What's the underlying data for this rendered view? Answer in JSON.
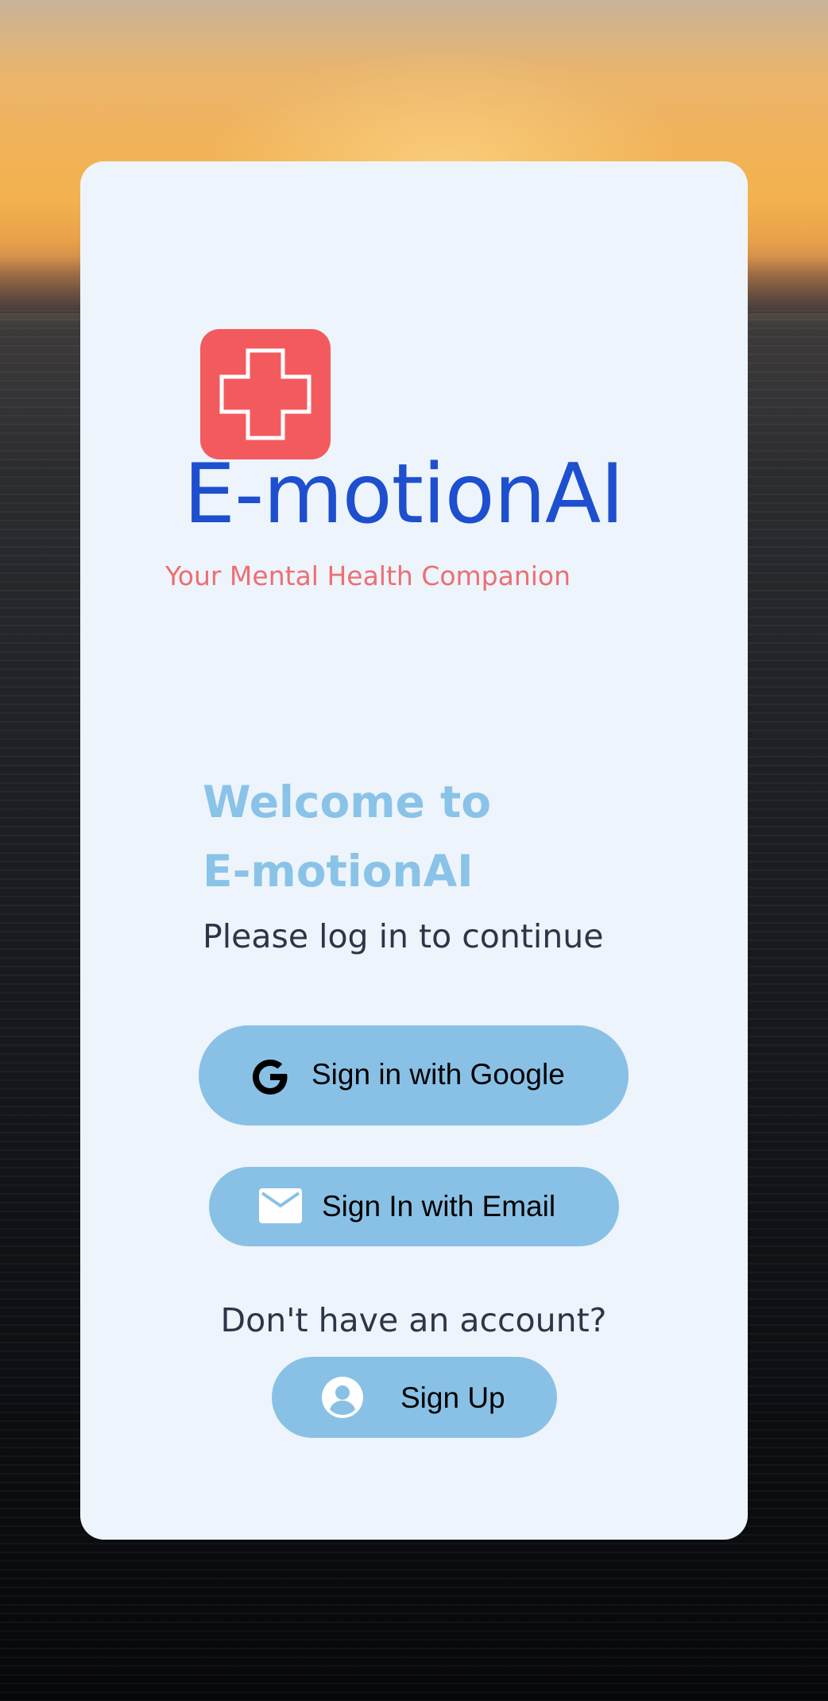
{
  "brand": {
    "name": "E-motionAI",
    "tagline": "Your Mental Health Companion",
    "logo_icon": "medical-cross-icon",
    "logo_color": "#f35a5e",
    "name_color": "#1d4fcf",
    "tagline_color": "#ec6f73"
  },
  "welcome": {
    "line1": "Welcome to",
    "line2": "E-motionAI",
    "subtitle": "Please log in to continue",
    "title_color": "#8ac3e8"
  },
  "actions": {
    "google": {
      "label": "Sign in with Google",
      "icon": "google-icon"
    },
    "email": {
      "label": "Sign In with Email",
      "icon": "mail-icon"
    },
    "signup_prompt": "Don't have an account?",
    "signup": {
      "label": "Sign Up",
      "icon": "account-circle-icon"
    },
    "button_color": "#89c1e6"
  },
  "card_color": "#eef4fb"
}
